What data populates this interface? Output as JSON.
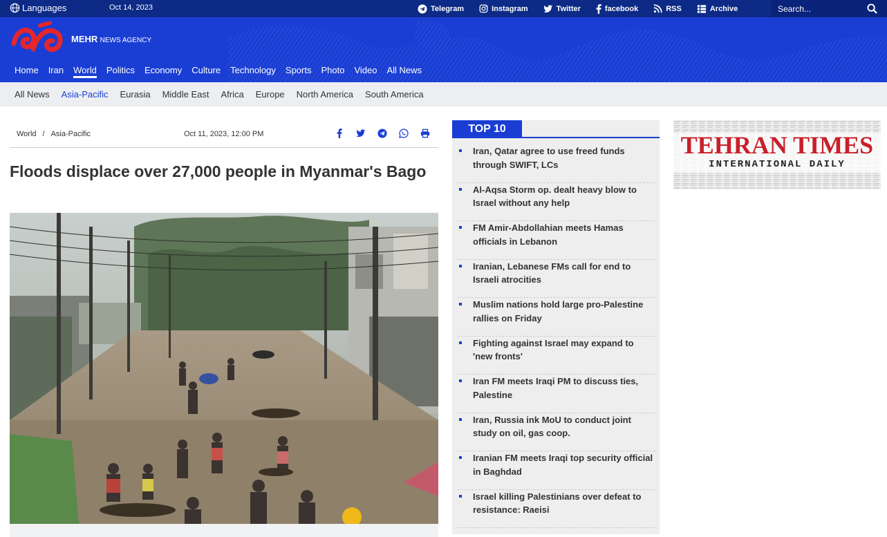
{
  "topbar": {
    "languages_label": "Languages",
    "date": "Oct 14, 2023",
    "social": [
      {
        "icon": "telegram-icon",
        "label": "Telegram"
      },
      {
        "icon": "instagram-icon",
        "label": "Instagram"
      },
      {
        "icon": "twitter-icon",
        "label": "Twitter"
      },
      {
        "icon": "facebook-icon",
        "label": "facebook"
      },
      {
        "icon": "rss-icon",
        "label": "RSS"
      },
      {
        "icon": "archive-icon",
        "label": "Archive"
      }
    ],
    "search_placeholder": "Search..."
  },
  "header": {
    "brand_bold": "MEHR",
    "brand_rest": "NEWS AGENCY",
    "nav": [
      "Home",
      "Iran",
      "World",
      "Politics",
      "Economy",
      "Culture",
      "Technology",
      "Sports",
      "Photo",
      "Video",
      "All News"
    ],
    "nav_active": "World"
  },
  "subnav": {
    "items": [
      "All News",
      "Asia-Pacific",
      "Eurasia",
      "Middle East",
      "Africa",
      "Europe",
      "North America",
      "South America"
    ],
    "active": "Asia-Pacific"
  },
  "article": {
    "breadcrumb": [
      "World",
      "Asia-Pacific"
    ],
    "breadcrumb_sep": "/",
    "date": "Oct 11, 2023, 12:00 PM",
    "title": "Floods displace over 27,000 people in Myanmar's Bago",
    "share_icons": [
      "facebook-icon",
      "twitter-icon",
      "telegram-icon",
      "whatsapp-icon",
      "print-icon"
    ]
  },
  "top10": {
    "heading": "TOP 10",
    "items": [
      "Iran, Qatar agree to use freed funds through SWIFT, LCs",
      "Al-Aqsa Storm op. dealt heavy blow to Israel without any help",
      "FM Amir-Abdollahian meets Hamas officials in Lebanon",
      "Iranian, Lebanese FMs call for end to Israeli atrocities",
      "Muslim nations hold large pro-Palestine rallies on Friday",
      "Fighting against Israel may expand to 'new fronts'",
      "Iran FM meets Iraqi PM to discuss ties, Palestine",
      "Iran, Russia ink MoU to conduct joint study on oil, gas coop.",
      "Iranian FM meets Iraqi top security official in Baghdad",
      "Israel killing Palestinians over defeat to resistance: Raeisi"
    ]
  },
  "ad": {
    "line1": "TEHRAN TIMES",
    "line2": "INTERNATIONAL DAILY"
  },
  "colors": {
    "brand_blue": "#1a3ed4",
    "topbar_navy": "#0c2a86",
    "logo_red": "#e5262c"
  }
}
